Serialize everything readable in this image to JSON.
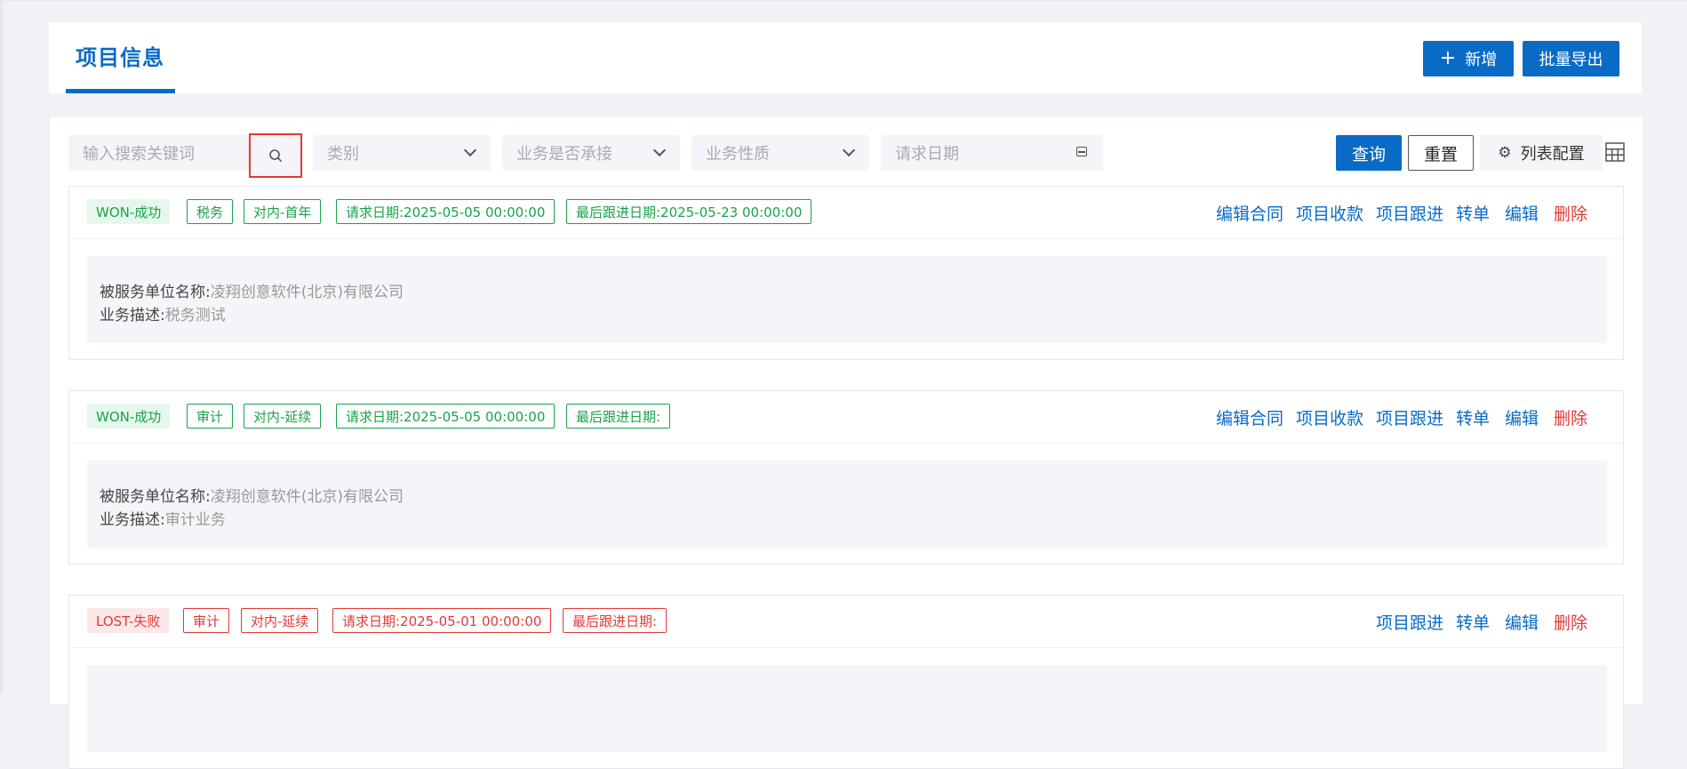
{
  "header": {
    "title": "项目信息",
    "add_label": "新增",
    "export_label": "批量导出"
  },
  "filters": {
    "search_placeholder": "输入搜索关键词",
    "category_placeholder": "类别",
    "undertaken_placeholder": "业务是否承接",
    "nature_placeholder": "业务性质",
    "date_placeholder": "请求日期",
    "query_label": "查询",
    "reset_label": "重置",
    "column_config_label": "列表配置"
  },
  "labels": {
    "client_key": "被服务单位名称:",
    "desc_key": "业务描述:"
  },
  "projects": [
    {
      "status": "WON-成功",
      "type": "税务",
      "nature": "对内-首年",
      "request_date": "请求日期:2025-05-05 00:00:00",
      "follow_date": "最后跟进日期:2025-05-23 00:00:00",
      "client": "凌翔创意软件(北京)有限公司",
      "description": "税务测试",
      "actions": [
        "编辑合同",
        "项目收款",
        "项目跟进",
        "转单",
        "编辑",
        "删除"
      ]
    },
    {
      "status": "WON-成功",
      "type": "审计",
      "nature": "对内-延续",
      "request_date": "请求日期:2025-05-05 00:00:00",
      "follow_date": "最后跟进日期:",
      "client": "凌翔创意软件(北京)有限公司",
      "description": "审计业务",
      "actions": [
        "编辑合同",
        "项目收款",
        "项目跟进",
        "转单",
        "编辑",
        "删除"
      ]
    },
    {
      "status": "LOST-失败",
      "type": "审计",
      "nature": "对内-延续",
      "request_date": "请求日期:2025-05-01 00:00:00",
      "follow_date": "最后跟进日期:",
      "actions": [
        "项目跟进",
        "转单",
        "编辑",
        "删除"
      ]
    }
  ],
  "colors": {
    "primary": "#0a6bc5",
    "success": "#1aa34a",
    "danger": "#e53935"
  }
}
